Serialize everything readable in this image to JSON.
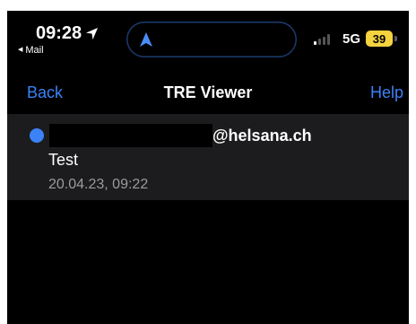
{
  "status_bar": {
    "time": "09:28",
    "back_app": "Mail",
    "network": "5G",
    "battery": "39",
    "icons": [
      "location-arrow-icon",
      "navigation-arrow-icon",
      "signal-bars-icon"
    ]
  },
  "nav": {
    "back_label": "Back",
    "title": "TRE Viewer",
    "help_label": "Help"
  },
  "message": {
    "sender_visible": "@helsana.ch",
    "sender_redacted": true,
    "subject": "Test",
    "datetime": "20.04.23, 09:22",
    "unread": true
  },
  "colors": {
    "accent": "#3b82f6",
    "battery": "#f4d33f",
    "row_background": "#1c1c1e",
    "background": "#000000"
  }
}
